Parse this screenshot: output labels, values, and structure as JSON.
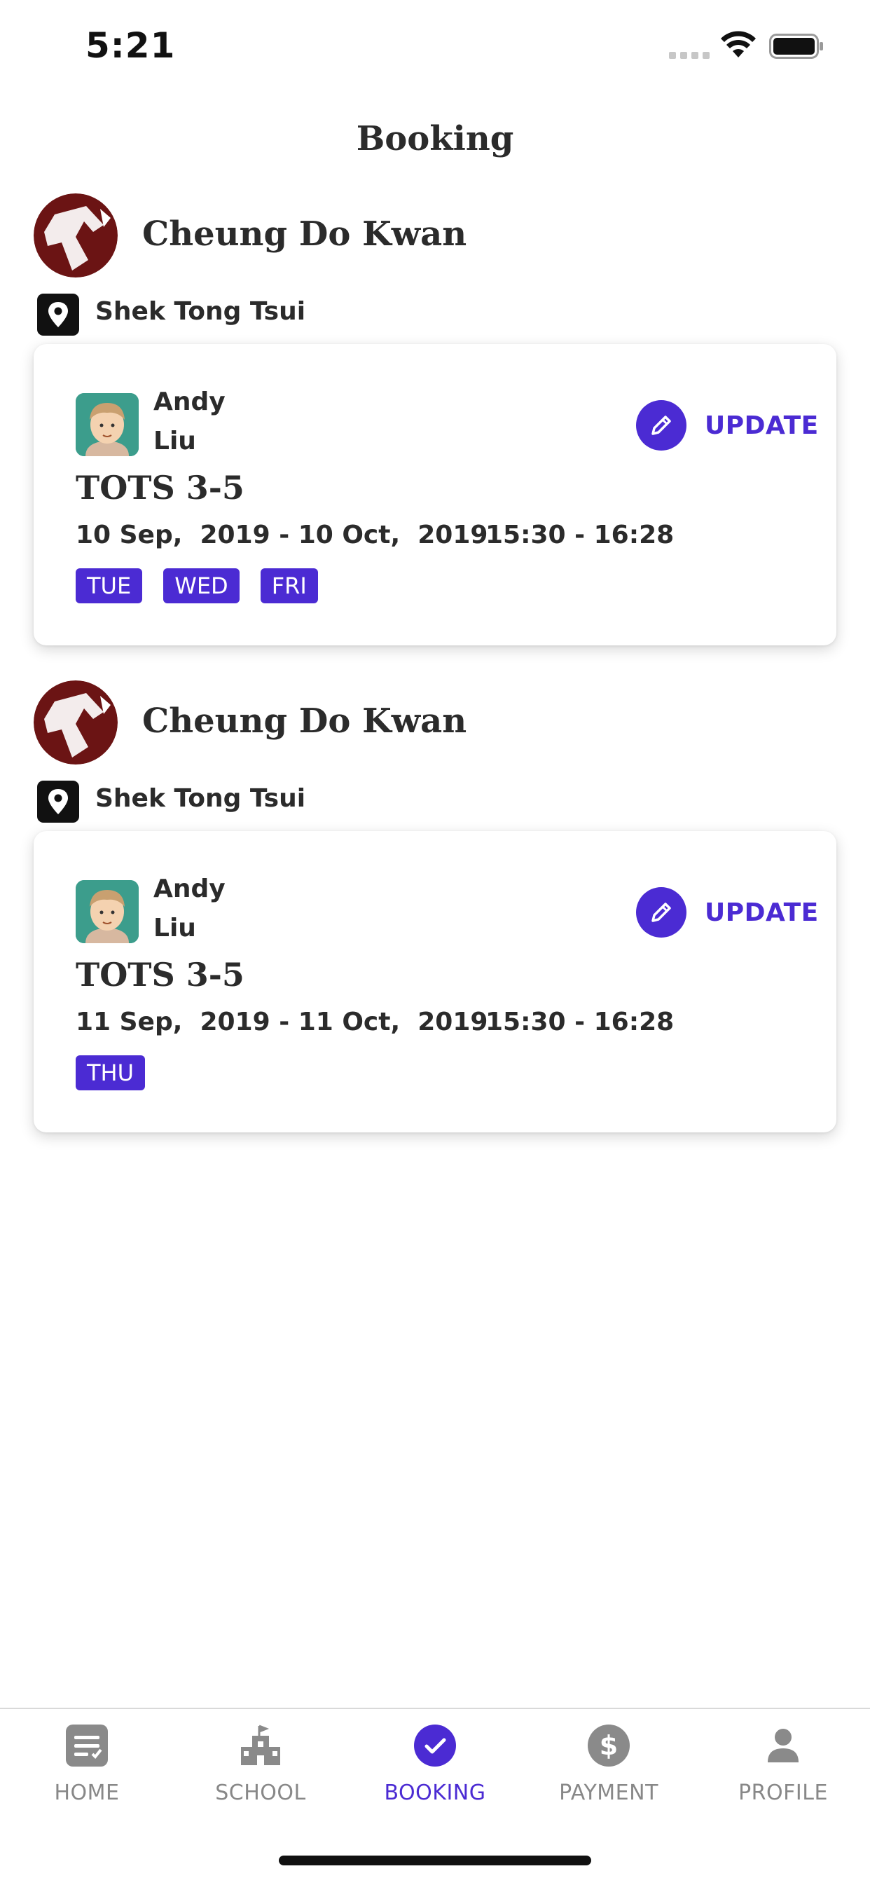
{
  "status_bar": {
    "time": "5:21"
  },
  "page_title": "Booking",
  "bookings": [
    {
      "school_name": "Cheung Do Kwan",
      "location": "Shek Tong Tsui",
      "student_first": "Andy",
      "student_last": "Liu",
      "update_label": "UPDATE",
      "course": "TOTS 3-5",
      "date_range": "10 Sep,  2019 - 10 Oct,  2019",
      "time_range": "15:30 - 16:28",
      "days": [
        "TUE",
        "WED",
        "FRI"
      ]
    },
    {
      "school_name": "Cheung Do Kwan",
      "location": "Shek Tong Tsui",
      "student_first": "Andy",
      "student_last": "Liu",
      "update_label": "UPDATE",
      "course": "TOTS 3-5",
      "date_range": "11 Sep,  2019 - 11 Oct,  2019",
      "time_range": "15:30 - 16:28",
      "days": [
        "THU"
      ]
    }
  ],
  "tabs": [
    {
      "label": "HOME",
      "icon": "home-icon",
      "active": false
    },
    {
      "label": "SCHOOL",
      "icon": "school-icon",
      "active": false
    },
    {
      "label": "BOOKING",
      "icon": "booking-check-icon",
      "active": true
    },
    {
      "label": "PAYMENT",
      "icon": "dollar-icon",
      "active": false
    },
    {
      "label": "PROFILE",
      "icon": "profile-icon",
      "active": false
    }
  ],
  "colors": {
    "accent": "#4b2bd3",
    "inactive": "#888888",
    "logo": "#6b1414",
    "avatar_bg": "#3c9d8c"
  }
}
